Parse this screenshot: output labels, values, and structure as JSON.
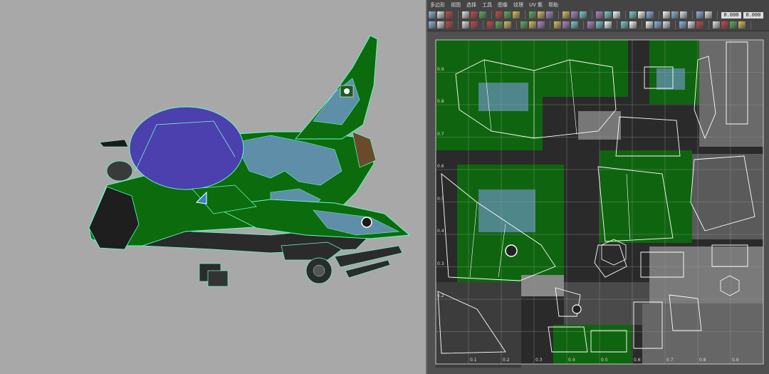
{
  "uv_editor": {
    "menu": [
      {
        "id": "polygons",
        "label": "多边形"
      },
      {
        "id": "view",
        "label": "视图"
      },
      {
        "id": "select",
        "label": "选择"
      },
      {
        "id": "tool",
        "label": "工具"
      },
      {
        "id": "image",
        "label": "图像"
      },
      {
        "id": "texture",
        "label": "纹理"
      },
      {
        "id": "uvsets",
        "label": "UV 集"
      },
      {
        "id": "help",
        "label": "帮助"
      }
    ],
    "fields": {
      "u_value": "0.000",
      "v_value": "0.000"
    },
    "v_ticks": [
      "0.9",
      "0.8",
      "0.7",
      "0.6",
      "0.5",
      "0.4",
      "0.3",
      "0.2"
    ],
    "u_ticks": [
      "0.1",
      "0.2",
      "0.3",
      "0.4",
      "0.5",
      "0.6",
      "0.7",
      "0.8",
      "0.9"
    ]
  },
  "colors": {
    "viewport_bg": "#a8a8a8",
    "camo_green": "#0c6b0c",
    "camo_blue": "#5e8ea8",
    "canopy": "#4c3fae",
    "wire": "#66ffcc",
    "uv_grid": "#9a9a9a",
    "uv_shell": "#ffffff"
  }
}
